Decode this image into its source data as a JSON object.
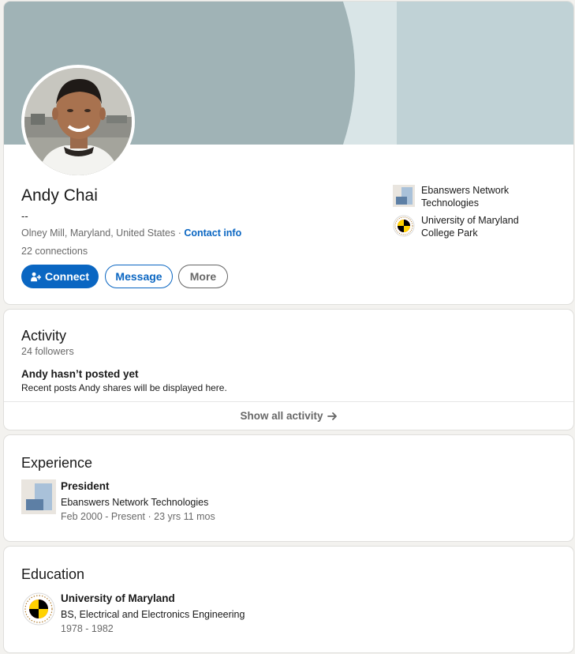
{
  "profile": {
    "name": "Andy Chai",
    "headline": "--",
    "location": "Olney Mill, Maryland, United States",
    "location_separator": " · ",
    "contact_info_label": "Contact info",
    "connections": "22 connections",
    "buttons": {
      "connect": "Connect",
      "message": "Message",
      "more": "More"
    },
    "organizations": [
      {
        "name": "Ebanswers Network Technologies",
        "icon": "company-logo"
      },
      {
        "name": "University of Maryland College Park",
        "icon": "university-seal"
      }
    ]
  },
  "activity": {
    "title": "Activity",
    "followers": "24 followers",
    "empty_title": "Andy hasn’t posted yet",
    "empty_desc": "Recent posts Andy shares will be displayed here.",
    "show_all": "Show all activity"
  },
  "experience": {
    "title": "Experience",
    "items": [
      {
        "role": "President",
        "company": "Ebanswers Network Technologies",
        "dates": "Feb 2000 - Present · 23 yrs 11 mos"
      }
    ]
  },
  "education": {
    "title": "Education",
    "items": [
      {
        "school": "University of Maryland",
        "degree": "BS, Electrical and Electronics Engineering",
        "years": "1978 - 1982"
      }
    ]
  },
  "colors": {
    "brand_blue": "#0a66c2",
    "banner": "#a0b3b6",
    "page_bg": "#f3f2ef"
  }
}
